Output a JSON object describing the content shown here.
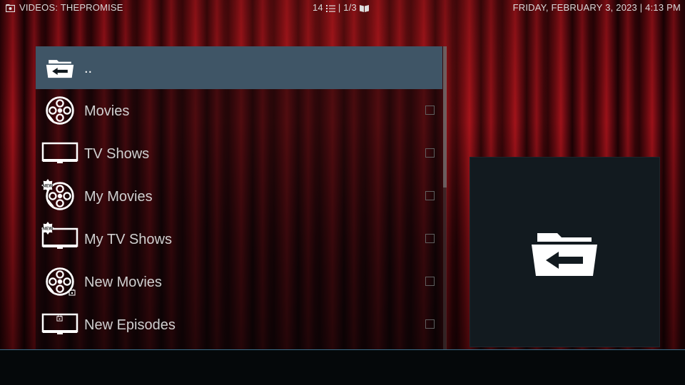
{
  "header": {
    "title": "VIDEOS: THEPROMISE",
    "item_count": "14",
    "page": "| 1/3",
    "datetime": "FRIDAY, FEBRUARY 3, 2023 | 4:13 PM"
  },
  "list": {
    "items": [
      {
        "label": "..",
        "icon": "folder-back-icon",
        "selected": true
      },
      {
        "label": "Movies",
        "icon": "film-reel-icon",
        "selected": false
      },
      {
        "label": "TV Shows",
        "icon": "tv-icon",
        "selected": false
      },
      {
        "label": "My Movies",
        "icon": "film-reel-new-badge-icon",
        "selected": false
      },
      {
        "label": "My TV Shows",
        "icon": "tv-new-badge-icon",
        "selected": false
      },
      {
        "label": "New Movies",
        "icon": "film-reel-calendar-icon",
        "selected": false
      },
      {
        "label": "New Episodes",
        "icon": "tv-calendar-icon",
        "selected": false
      }
    ]
  },
  "preview": {
    "icon": "folder-back-icon"
  },
  "colors": {
    "selected_row": "#3f5566",
    "accent_line": "#3a6f8a",
    "curtain": "#a3121a"
  }
}
